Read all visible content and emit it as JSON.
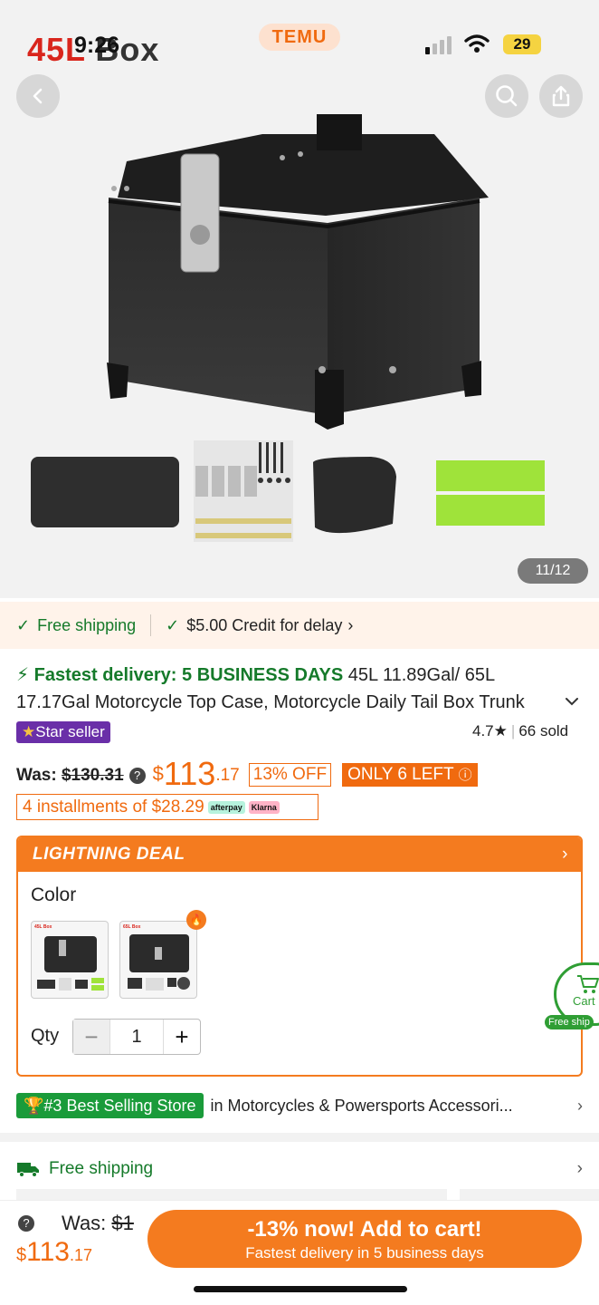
{
  "status_bar": {
    "time": "9:26",
    "brand": "TEMU",
    "battery": "29"
  },
  "hero": {
    "overlay_title_red": "45L",
    "overlay_title_dark": "Box",
    "image_counter": "11/12",
    "icons": [
      "chevron-left-icon",
      "search-icon",
      "share-icon"
    ]
  },
  "shipping_bar": {
    "free_shipping": "Free shipping",
    "credit": "$5.00 Credit for delay"
  },
  "product": {
    "fast_delivery": "Fastest delivery: 5 BUSINESS DAYS",
    "title_line1_rest": " 45L 11.89Gal/ 65L",
    "title_line2": "17.17Gal Motorcycle Top Case, Motorcycle Daily Tail Box Trunk",
    "star_seller": "Star seller",
    "rating": "4.7",
    "sold": "66 sold"
  },
  "price": {
    "was_label": "Was:",
    "was_value": "$130.31",
    "currency": "$",
    "main": "113",
    "cents": ".17",
    "discount": "13% OFF",
    "stock": "ONLY 6 LEFT",
    "installments": "4 installments of $28.29",
    "afterpay": "afterpay",
    "klarna": "Klarna"
  },
  "deal": {
    "header": "LIGHTNING DEAL",
    "color_label": "Color",
    "options": [
      {
        "tag": "45L Box",
        "selected": true
      },
      {
        "tag": "65L Box",
        "selected": false
      }
    ],
    "qty_label": "Qty",
    "qty_value": "1",
    "minus": "−",
    "plus": "+"
  },
  "floating_cart": {
    "label": "Cart",
    "free_ship": "Free ship"
  },
  "store": {
    "badge": "#3 Best Selling Store",
    "text": "in Motorcycles & Powersports Accessori..."
  },
  "free_shipping_row": {
    "label": "Free shipping"
  },
  "bottom_bar": {
    "was_label": "Was:",
    "was_value": "$1",
    "currency": "$",
    "main": "113",
    "cents": ".17",
    "cta_line1": "-13% now! Add to cart!",
    "cta_line2": "Fastest delivery in 5 business days"
  },
  "colors": {
    "accent_orange": "#f47b1f",
    "price_orange": "#f06a0f",
    "green": "#157a2a",
    "star_purple": "#6a2fa8"
  }
}
